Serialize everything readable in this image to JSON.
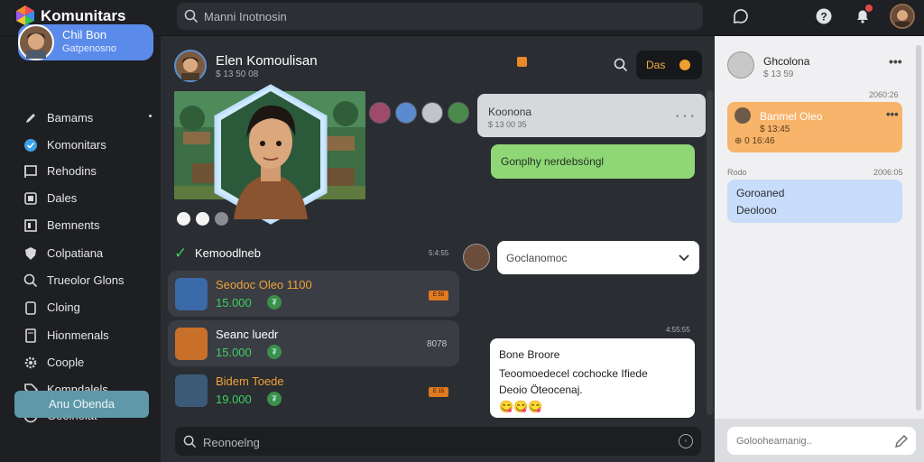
{
  "app": {
    "name": "Komunitars"
  },
  "search": {
    "placeholder": "Manni Inotnosin"
  },
  "profile": {
    "name": "Chil Bon",
    "subtitle": "Gatpenosno"
  },
  "sidebar": {
    "items": [
      {
        "label": "Bamams",
        "icon": "pen-icon"
      },
      {
        "label": "Komonitars",
        "icon": "check-circle-icon"
      },
      {
        "label": "Rehodins",
        "icon": "flag-icon"
      },
      {
        "label": "Dales",
        "icon": "square-icon"
      },
      {
        "label": "Bemnents",
        "icon": "box-icon"
      },
      {
        "label": "Colpatiana",
        "icon": "shield-icon"
      },
      {
        "label": "Trueolor Glons",
        "icon": "search-icon"
      },
      {
        "label": "Cloing",
        "icon": "clipboard-icon"
      },
      {
        "label": "Hionmenals",
        "icon": "tablet-icon"
      },
      {
        "label": "Coople",
        "icon": "gear-icon"
      },
      {
        "label": "Komndalels",
        "icon": "tag-icon"
      },
      {
        "label": "Geoinoiat",
        "icon": "globe-icon"
      }
    ],
    "add_button": "Anu Obenda"
  },
  "chat": {
    "title": "Elen Komoulisan",
    "subtitle": "$ 13 50 08",
    "call_label": "Das",
    "gray_bubble": {
      "title": "Koonona",
      "subtitle": "$ 13 00 35",
      "dots": "• • •"
    },
    "green_bubble": "Gonplhy nerdebsöngl",
    "section": {
      "title": "Kemoodlneb",
      "time": "5:4:55"
    },
    "list": [
      {
        "title": "Seodoc Oleo 1100",
        "price": "15.000",
        "badge": "E 55",
        "meta": "",
        "title_color": "#f0a23a"
      },
      {
        "title": "Seanc luedr",
        "price": "15.000",
        "badge": "",
        "meta": "8078",
        "title_color": "#ffffff"
      },
      {
        "title": "Bidem Toede",
        "price": "19.000",
        "badge": "E 15",
        "meta": "",
        "title_color": "#f0a23a"
      }
    ],
    "dropdown_value": "Goclanomoc",
    "msg_time": "4:55:55",
    "message": {
      "title": "Bone Broore",
      "line1": "Teoomoedecel cochocke Ifiede",
      "line2": "Deoio Öteocenaj.",
      "emojis": "😋😋😋"
    },
    "composer_placeholder": "Reonoelng"
  },
  "right_panel": {
    "head": {
      "title": "Ghcolona",
      "subtitle": "$ 13 59"
    },
    "time1": "2060:26",
    "orange": {
      "title": "Banmel Oleo",
      "sub": "$ 13:45",
      "line2": "⊕ 0 16:46"
    },
    "label2": "Rodo",
    "time2": "2006:05",
    "blue": {
      "title": "Goroaned",
      "sub": "Deolooo"
    },
    "input_placeholder": "Golooheamanig.."
  },
  "colors": {
    "accent_blue": "#5b8bea",
    "green": "#3cd162",
    "orange": "#f0a23a"
  }
}
